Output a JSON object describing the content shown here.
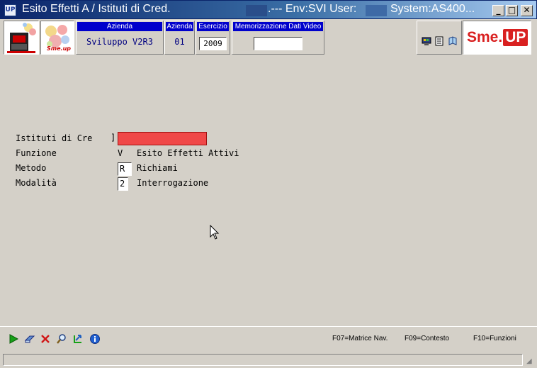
{
  "window": {
    "app_icon": "UP",
    "title": "Esito Effetti A / Istituti di Cred.",
    "env_text": ".--- Env:SVI User:",
    "system_text": "System:AS400...",
    "min_glyph": "_",
    "max_glyph": "□",
    "close_glyph": "✕"
  },
  "header": {
    "azienda_label": "Azienda",
    "azienda_value": "Sviluppo V2R3",
    "azienda_code_label": "Azienda",
    "azienda_code": "01",
    "esercizio_label": "Esercizio",
    "esercizio_value": "2009",
    "memorizzazione_label": "Memorizzazione Dati Video",
    "memorizzazione_value": "",
    "smeup_text": "Sme.",
    "smeup_up": "UP",
    "logo2_text": "Sme.up"
  },
  "form": {
    "istituti_label": "Istituti di Cre",
    "istituti_bracket": "]",
    "istituti_value": "",
    "funzione_label": "Funzione",
    "funzione_code": "V",
    "funzione_desc": "Esito Effetti Attivi",
    "metodo_label": "Metodo",
    "metodo_value": "R",
    "metodo_desc": "Richiami",
    "modalita_label": "Modalità",
    "modalita_value": "2",
    "modalita_desc": "Interrogazione"
  },
  "footer": {
    "f07": "F07=Matrice Nav.",
    "f09": "F09=Contesto",
    "f10": "F10=Funzioni"
  },
  "colors": {
    "error_field": "#f04848",
    "label_bg": "#0000cc",
    "brand_red": "#d92020"
  }
}
